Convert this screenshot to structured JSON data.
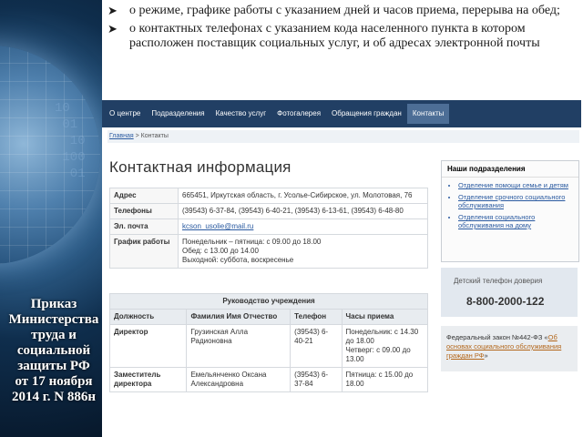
{
  "bullets": [
    "о режиме, графике работы с указанием дней и часов приема, перерыва на обед;",
    "о контактных телефонах с указанием кода населенного пункта в котором расположен поставщик социальных услуг, и об адресах электронной почты"
  ],
  "left_panel": {
    "order_text": "Приказ\nМинистерства\nтруда и\nсоциальной\nзащиты РФ\nот 17 ноября\n2014 г. N 886н"
  },
  "nav": {
    "items": [
      "О центре",
      "Подразделения",
      "Качество услуг",
      "Фотогалерея",
      "Обращения граждан",
      "Контакты"
    ],
    "active": "Контакты"
  },
  "breadcrumb": {
    "home": "Главная",
    "sep": ">",
    "current": "Контакты"
  },
  "page_title": "Контактная информация",
  "contact": {
    "address_label": "Адрес",
    "address": "665451, Иркутская область, г. Усолье-Сибирское, ул. Молотовая, 76",
    "phones_label": "Телефоны",
    "phones": "(39543) 6-37-84, (39543) 6-40-21, (39543) 6-13-61, (39543) 6-48-80",
    "email_label": "Эл. почта",
    "email": "kcson_usolie@mail.ru",
    "schedule_label": "График работы",
    "schedule_1": "Понедельник – пятница: с 09.00 до 18.00",
    "schedule_2": "Обед: с 13.00 до 14.00",
    "schedule_3": "Выходной: суббота, воскресенье"
  },
  "management": {
    "caption": "Руководство учреждения",
    "headers": [
      "Должность",
      "Фамилия Имя Отчество",
      "Телефон",
      "Часы приема"
    ],
    "rows": [
      [
        "Директор",
        "Грузинская Алла Радионовна",
        "(39543) 6-40-21",
        "Понедельник: с 14.30 до 18.00\nЧетверг: с 09.00 до 13.00"
      ],
      [
        "Заместитель директора",
        "Емельянченко Оксана Александровна",
        "(39543) 6-37-84",
        "Пятница: с 15.00 до 18.00"
      ]
    ]
  },
  "sidebar": {
    "title": "Наши подразделения",
    "links": [
      "Отделение помощи семье и детям",
      "Отделение срочного социального обслуживания",
      "Отделения социального обслуживания на дому"
    ],
    "hotline_title": "Детский телефон доверия",
    "hotline_number": "8-800-2000-122",
    "law_prefix": "Федеральный закон №442-ФЗ «",
    "law_link": "Об основах социального обслуживания граждан РФ",
    "law_suffix": "»"
  }
}
